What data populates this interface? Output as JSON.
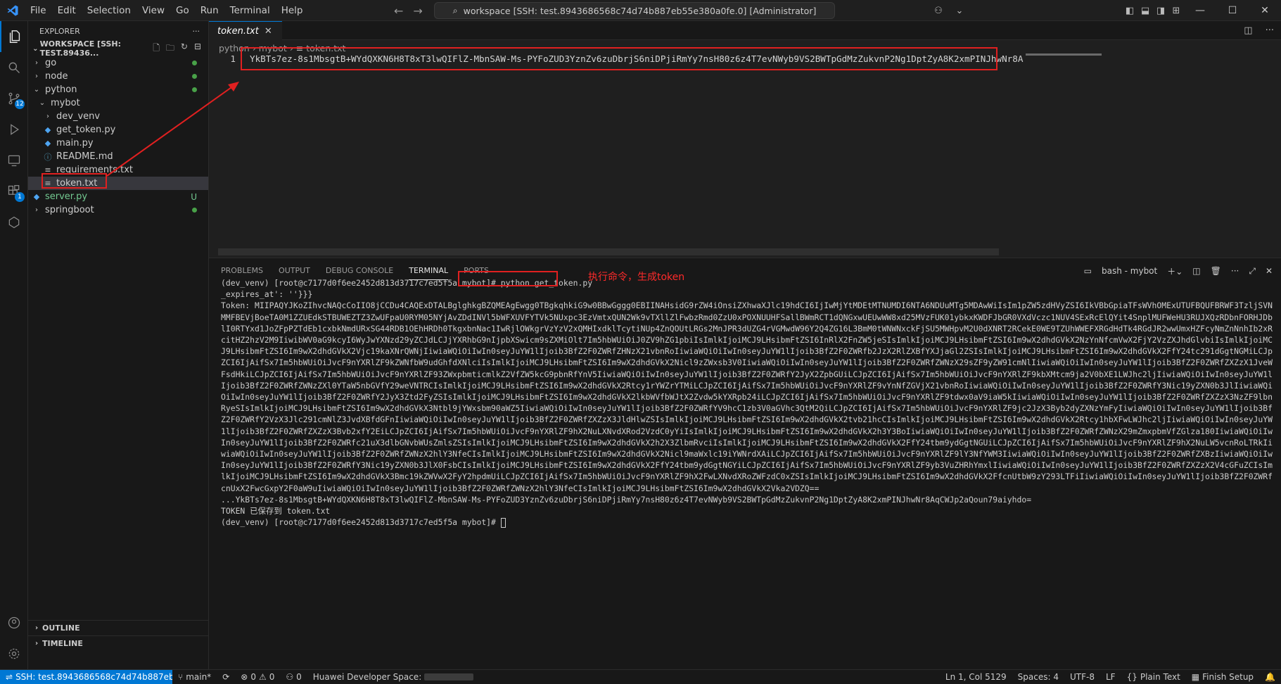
{
  "titlebar": {
    "menu": [
      "File",
      "Edit",
      "Selection",
      "View",
      "Go",
      "Run",
      "Terminal",
      "Help"
    ],
    "command_center": "workspace [SSH: test.8943686568c74d74b887eb55e380a0fe.0] [Administrator]"
  },
  "activity": {
    "scm_badge": "12",
    "ext_badge": "1"
  },
  "explorer": {
    "title": "EXPLORER",
    "workspace": "WORKSPACE [SSH: TEST.89436...",
    "items": [
      {
        "label": "go",
        "kind": "folder",
        "depth": 1,
        "open": false,
        "status": "dot"
      },
      {
        "label": "node",
        "kind": "folder",
        "depth": 1,
        "open": false,
        "status": "dot"
      },
      {
        "label": "python",
        "kind": "folder",
        "depth": 1,
        "open": true,
        "status": "dot"
      },
      {
        "label": "mybot",
        "kind": "folder",
        "depth": 2,
        "open": true,
        "status": ""
      },
      {
        "label": "dev_venv",
        "kind": "folder",
        "depth": 3,
        "open": false,
        "status": ""
      },
      {
        "label": "get_token.py",
        "kind": "py",
        "depth": 3,
        "status": ""
      },
      {
        "label": "main.py",
        "kind": "py",
        "depth": 3,
        "status": ""
      },
      {
        "label": "README.md",
        "kind": "md",
        "depth": 3,
        "status": ""
      },
      {
        "label": "requirements.txt",
        "kind": "txt",
        "depth": 3,
        "status": ""
      },
      {
        "label": "token.txt",
        "kind": "txt",
        "depth": 3,
        "status": "",
        "selected": true
      },
      {
        "label": "server.py",
        "kind": "py",
        "depth": 1,
        "status": "U"
      },
      {
        "label": "springboot",
        "kind": "folder",
        "depth": 1,
        "open": false,
        "status": "dot"
      }
    ],
    "outline": "OUTLINE",
    "timeline": "TIMELINE"
  },
  "editor": {
    "tab": "token.txt",
    "breadcrumb": [
      "python",
      "mybot",
      "token.txt"
    ],
    "line_number": "1",
    "line_text": "YkBTs7ez-8s1MbsgtB+WYdQXKN6H8T8xT3lwQIFlZ-MbnSAW-Ms-PYFoZUD3YznZv6zuDbrjS6niDPjiRmYy7nsH80z6z4T7evNWyb9VS2BWTpGdMzZukvnP2Ng1DptZyA8K2xmPINJhwNr8AqCWJp2aQoun79aiyhdo="
  },
  "panel": {
    "tabs": [
      "PROBLEMS",
      "OUTPUT",
      "DEBUG CONSOLE",
      "TERMINAL",
      "PORTS"
    ],
    "active_tab": "TERMINAL",
    "terminal_name": "bash - mybot",
    "prompt_line": "(dev_venv) [root@c7177d0f6ee2452d813d3717c7ed5f5a mybot]# python get_token.py",
    "expires_line": "_expires_at': ''}}}",
    "token_output": "Token: MIIPAQYJKoZIhvcNAQcCoIIO8jCCDu4CAQExDTALBglghkgBZQMEAgEwgg0TBgkqhkiG9w0BBwGggg0EBIINAHsidG9rZW4iOnsiZXhwaXJlc19hdCI6IjIwMjYtMDEtMTNUMDI6NTA6NDUuMTg5MDAwWiIsIm1pZW5zdHVyZSI6IkVBbGpiaTFsWVhOMExUTUFBQUFBRWF3TzljSVNMMFBEVjBoeTA0M1ZZUEdkSTBUWEZTZ3ZwUFpaU0RYM05NYjAvZDdINVl5bWFXUVFYTVk5NUxpc3EzVmtxQUN2Wk9vTXllZlFwbzRmd0ZzU0xPOXNUUHFSallBWmRCT1dQNGxwUEUwWW8xd25MVzFUK01ybkxKWDFJbGR0VXdVczc1NUV4SExRcElQYit4SnplMUFWeHU3RUJXQzRDbnFORHJDblI0RTYxd1JoZFpPZTdEb1cxbkNmdURxSG44RDB1OEhHRDh0TkgxbnNac1IwRjlOWkgrVzYzV2xQMHIxdklTcytiNUp4ZnQOUtLRGs2MnJPR3dUZG4rVGMwdW96Y2Q4ZG16L3BmM0tWNWNxckFjSU5MWHpvM2U0dXNRT2RCekE0WE9TZUhWWEFXRGdHdTk4RGdJR2wwUmxHZFcyNmZnNnhIb2xRcitHZ2hzV2M9IiwibWV0aG9kcyI6WyJwYXNzd29yZCJdLCJjYXRhbG9nIjpbXSwicm9sZXMiOlt7Im5hbWUiOiJ0ZV9hZG1pbiIsImlkIjoiMCJ9LHsibmFtZSI6InRlX2FnZW5jeSIsImlkIjoiMCJ9LHsibmFtZSI6Im9wX2dhdGVkX2NzYnNfcmVwX2FjY2VzZXJhdGlvbiIsImlkIjoiMCJ9LHsibmFtZSI6Im9wX2dhdGVkX2Vjc19kaXNrQWNjIiwiaWQiOiIwIn0seyJuYW1lIjoib3BfZ2F0ZWRfZHNzX21vbnRoIiwiaWQiOiIwIn0seyJuYW1lIjoib3BfZ2F0ZWRfb2JzX2RlZXBfYXJjaGl2ZSIsImlkIjoiMCJ9LHsibmFtZSI6Im9wX2dhdGVkX2FfY24tc291dGgtNGMiLCJpZCI6IjAifSx7Im5hbWUiOiJvcF9nYXRlZF9kZWNfbW9udGhfdXNlciIsImlkIjoiMCJ9LHsibmFtZSI6Im9wX2dhdGVkX2Nicl9zZWxsb3V0IiwiaWQiOiIwIn0seyJuYW1lIjoib3BfZ2F0ZWRfZWNzX29sZF9yZW91cmNlIiwiaWQiOiIwIn0seyJuYW1lIjoib3BfZ2F0ZWRfZXZzX1JveWFsdHkiLCJpZCI6IjAifSx7Im5hbWUiOiJvcF9nYXRlZF93ZWxpbmticmlkZ2VfZW5kcG9pbnRfYnV5IiwiaWQiOiIwIn0seyJuYW1lIjoib3BfZ2F0ZWRfY2JyX2ZpbGUiLCJpZCI6IjAifSx7Im5hbWUiOiJvcF9nYXRlZF9kbXMtcm9ja2V0bXE1LWJhc2ljIiwiaWQiOiIwIn0seyJuYW1lIjoib3BfZ2F0ZWRfZWNzZXl0YTaW5nbGVfY29weVNTRCIsImlkIjoiMCJ9LHsibmFtZSI6Im9wX2dhdGVkX2Rtcy1rYWZrYTMiLCJpZCI6IjAifSx7Im5hbWUiOiJvcF9nYXRlZF9vYnNfZGVjX21vbnRoIiwiaWQiOiIwIn0seyJuYW1lIjoib3BfZ2F0ZWRfY3Nic19yZXN0b3JlIiwiaWQiOiIwIn0seyJuYW1lIjoib3BfZ2F0ZWRfY2JyX3Ztd2FyZSIsImlkIjoiMCJ9LHsibmFtZSI6Im9wX2dhdGVkX2lkbWVfbWJtX2Zvdw5kYXRpb24iLCJpZCI6IjAifSx7Im5hbWUiOiJvcF9nYXRlZF9tdwx0aV9iaW5kIiwiaWQiOiIwIn0seyJuYW1lIjoib3BfZ2F0ZWRfZXZzX3NzZF9lbnRyeSIsImlkIjoiMCJ9LHsibmFtZSI6Im9wX2dhdGVkX3Ntbl9jYWxsbm90aWZ5IiwiaWQiOiIwIn0seyJuYW1lIjoib3BfZ2F0ZWRfYV9hcC1zb3V0aGVhc3QtM2QiLCJpZCI6IjAifSx7Im5hbWUiOiJvcF9nYXRlZF9jc2JzX3Byb2dyZXNzYmFyIiwiaWQiOiIwIn0seyJuYW1lIjoib3BfZ2F0ZWRfY2VzX3Jlc291cmNlZ3JvdXBfdGFnIiwiaWQiOiIwIn0seyJuYW1lIjoib3BfZ2F0ZWRfZXZzX3JldHlwZSIsImlkIjoiMCJ9LHsibmFtZSI6Im9wX2dhdGVkX2tvb21hcCIsImlkIjoiMCJ9LHsibmFtZSI6Im9wX2dhdGVkX2Rtcy1hbXFwLWJhc2ljIiwiaWQiOiIwIn0seyJuYW1lIjoib3BfZ2F0ZWRfZXZzX3Bvb2xfY2EiLCJpZCI6IjAifSx7Im5hbWUiOiJvcF9nYXRlZF9hX2NuLXNvdXRod2VzdC0yYiIsImlkIjoiMCJ9LHsibmFtZSI6Im9wX2dhdGVkX2h3Y3BoIiwiaWQiOiIwIn0seyJuYW1lIjoib3BfZ2F0ZWRfZWNzX29mZmxpbmVfZGlza180IiwiaWQiOiIwIn0seyJuYW1lIjoib3BfZ2F0ZWRfc21uX3dlbGNvbWUsZmlsZSIsImlkIjoiMCJ9LHsibmFtZSI6Im9wX2dhdGVkX2h2X3ZlbmRvciIsImlkIjoiMCJ9LHsibmFtZSI6Im9wX2dhdGVkX2FfY24tbm9ydGgtNGUiLCJpZCI6IjAifSx7Im5hbWUiOiJvcF9nYXRlZF9hX2NuLW5vcnRoLTRkIiwiaWQiOiIwIn0seyJuYW1lIjoib3BfZ2F0ZWRfZWNzX2hlY3NfeCIsImlkIjoiMCJ9LHsibmFtZSI6Im9wX2dhdGVkX2Nicl9maWxlc19iYWNrdXAiLCJpZCI6IjAifSx7Im5hbWUiOiJvcF9nYXRlZF9lY3NfYWM3IiwiaWQiOiIwIn0seyJuYW1lIjoib3BfZ2F0ZWRfZXBzIiwiaWQiOiIwIn0seyJuYW1lIjoib3BfZ2F0ZWRfY3Nic19yZXN0b3JlX0FsbCIsImlkIjoiMCJ9LHsibmFtZSI6Im9wX2dhdGVkX2FfY24tbm9ydGgtNGYiLCJpZCI6IjAifSx7Im5hbWUiOiJvcF9nYXRlZF9yb3VuZHRhYmxlIiwiaWQiOiIwIn0seyJuYW1lIjoib3BfZ2F0ZWRfZXZzX2V4cGFuZCIsImlkIjoiMCJ9LHsibmFtZSI6Im9wX2dhdGVkX3Bmc19kZWVwX2FyY2hpdmUiLCJpZCI6IjAifSx7Im5hbWUiOiJvcF9nYXRlZF9hX2FwLXNvdXRoZWFzdC0xZSIsImlkIjoiMCJ9LHsibmFtZSI6Im9wX2dhdGVkX2FfcnUtbW9zY293LTFiIiwiaWQiOiIwIn0seyJuYW1lIjoib3BfZ2F0ZWRfcnUxX2FwcGxpY2F0aW9uIiwiaWQiOiIwIn0seyJuYW1lIjoib3BfZ2F0ZWRfZWNzX2hlY3NfeCIsImlkIjoiMCJ9LHsibmFtZSI6Im9wX2dhdGVkX2Vka2VDZQ==",
    "token_tail": "...YkBTs7ez-8s1MbsgtB+WYdQXKN6H8T8xT3lwQIFlZ-MbnSAW-Ms-PYFoZUD3YznZv6zuDbrjS6niDPjiRmYy7nsH80z6z4T7evNWyb9VS2BWTpGdMzZukvnP2Ng1DptZyA8K2xmPINJhwNr8AqCWJp2aQoun79aiyhdo=",
    "saved_line": "TOKEN 已保存到 token.txt",
    "final_prompt": "(dev_venv) [root@c7177d0f6ee2452d813d3717c7ed5f5a mybot]# "
  },
  "annotation": {
    "text": "执行命令，生成token",
    "color": "#ff2a2a"
  },
  "statusbar": {
    "remote": "SSH: test.8943686568c74d74b887eb55e380a0...",
    "branch": "main*",
    "errors": "0",
    "warnings": "0",
    "ports": "0",
    "space_label": "Huawei Developer Space:",
    "position": "Ln 1, Col 5129",
    "spaces": "Spaces: 4",
    "encoding": "UTF-8",
    "eol": "LF",
    "language": "Plain Text",
    "finish": "Finish Setup"
  }
}
